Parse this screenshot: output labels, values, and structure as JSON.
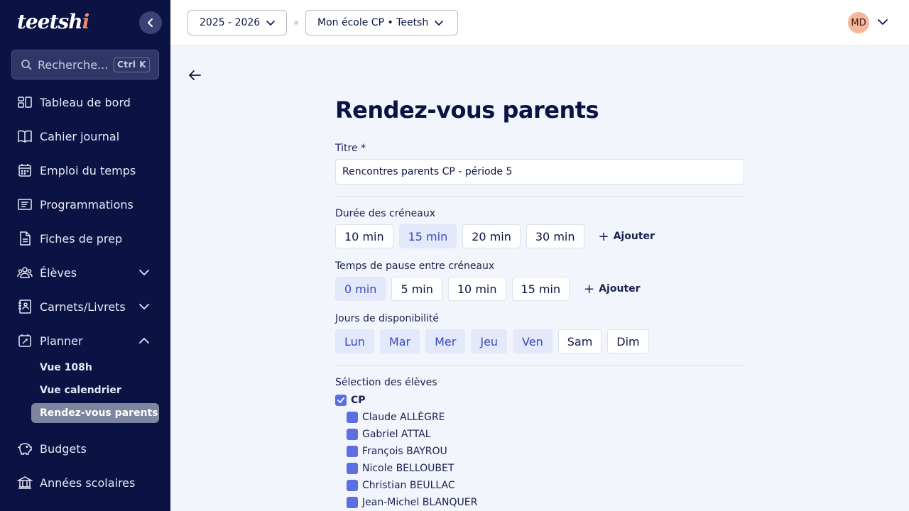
{
  "sidebar": {
    "logo_main": "teetsh",
    "logo_accent": "i",
    "search": {
      "label": "Recherche...",
      "shortcut": "Ctrl K"
    },
    "items": [
      {
        "label": "Tableau de bord",
        "icon": "dashboard-icon"
      },
      {
        "label": "Cahier journal",
        "icon": "book-icon"
      },
      {
        "label": "Emploi du temps",
        "icon": "calendar-icon"
      },
      {
        "label": "Programmations",
        "icon": "list-icon"
      },
      {
        "label": "Fiches de prep",
        "icon": "file-icon"
      },
      {
        "label": "Élèves",
        "icon": "students-icon"
      },
      {
        "label": "Carnets/Livrets",
        "icon": "notebook-icon"
      },
      {
        "label": "Planner",
        "icon": "planner-icon"
      },
      {
        "label": "Budgets",
        "icon": "piggy-bank-icon"
      },
      {
        "label": "Années scolaires",
        "icon": "school-icon"
      }
    ],
    "planner_sub": [
      {
        "label": "Vue 108h"
      },
      {
        "label": "Vue calendrier"
      },
      {
        "label": "Rendez-vous parents"
      }
    ]
  },
  "header": {
    "year_select": "2025 - 2026",
    "school_select": "Mon école CP • Teetsh",
    "avatar": "MD"
  },
  "main": {
    "title": "Rendez-vous parents",
    "title_field": {
      "label": "Titre *",
      "value": "Rencontres parents CP - période 5"
    },
    "duration": {
      "label": "Durée des créneaux",
      "options": [
        "10 min",
        "15 min",
        "20 min",
        "30 min"
      ],
      "selected": "15 min",
      "add": "Ajouter"
    },
    "pause": {
      "label": "Temps de pause entre créneaux",
      "options": [
        "0 min",
        "5 min",
        "10 min",
        "15 min"
      ],
      "selected": "0 min",
      "add": "Ajouter"
    },
    "days": {
      "label": "Jours de disponibilité",
      "options": [
        "Lun",
        "Mar",
        "Mer",
        "Jeu",
        "Ven",
        "Sam",
        "Dim"
      ],
      "selected": [
        "Lun",
        "Mar",
        "Mer",
        "Jeu",
        "Ven"
      ]
    },
    "students": {
      "label": "Sélection des élèves",
      "class_name": "CP",
      "list": [
        "Claude ALLÈGRE",
        "Gabriel ATTAL",
        "François BAYROU",
        "Nicole BELLOUBET",
        "Christian BEULLAC",
        "Jean-Michel BLANQUER"
      ]
    }
  },
  "colors": {
    "sidebar_bg": "#0b1244",
    "accent": "#5b6fe0",
    "chip_selected": "#e3e8fa"
  }
}
